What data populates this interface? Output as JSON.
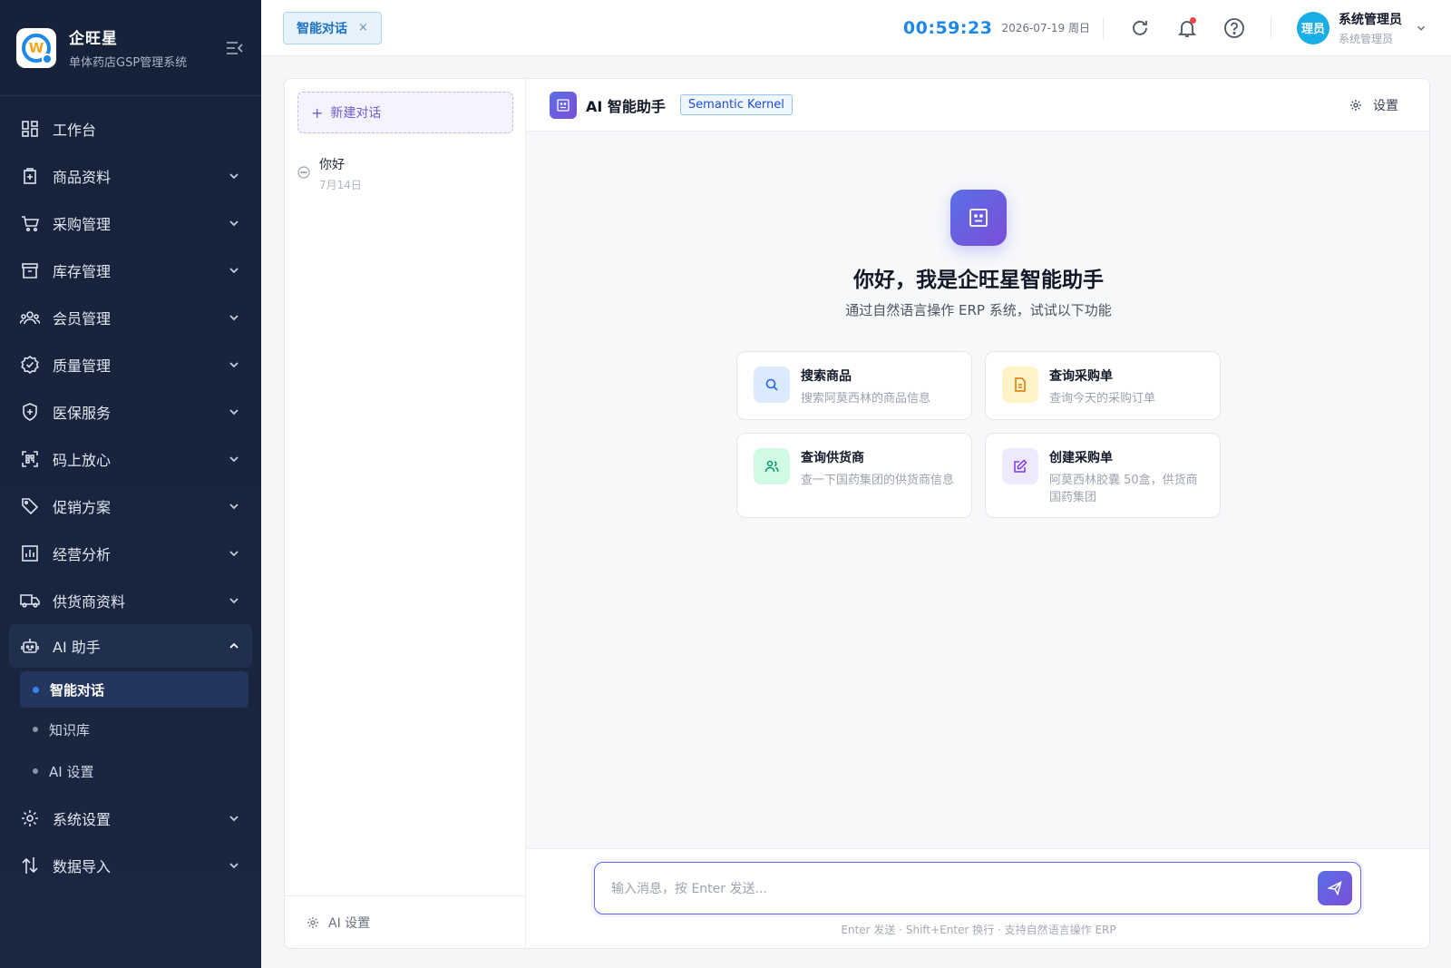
{
  "brand": {
    "name": "企旺星",
    "subtitle": "单体药店GSP管理系统"
  },
  "sidebar": {
    "items": [
      {
        "label": "工作台",
        "icon": "dashboard-icon"
      },
      {
        "label": "商品资料",
        "icon": "product-icon"
      },
      {
        "label": "采购管理",
        "icon": "cart-icon"
      },
      {
        "label": "库存管理",
        "icon": "archive-icon"
      },
      {
        "label": "会员管理",
        "icon": "members-icon"
      },
      {
        "label": "质量管理",
        "icon": "badge-check-icon"
      },
      {
        "label": "医保服务",
        "icon": "shield-plus-icon"
      },
      {
        "label": "码上放心",
        "icon": "qr-scan-icon"
      },
      {
        "label": "促销方案",
        "icon": "tag-icon"
      },
      {
        "label": "经营分析",
        "icon": "bar-chart-icon"
      },
      {
        "label": "供货商资料",
        "icon": "truck-icon"
      },
      {
        "label": "AI 助手",
        "icon": "robot-icon"
      },
      {
        "label": "系统设置",
        "icon": "gear-icon"
      },
      {
        "label": "数据导入",
        "icon": "import-arrows-icon"
      }
    ],
    "ai_sub": [
      {
        "label": "智能对话"
      },
      {
        "label": "知识库"
      },
      {
        "label": "AI 设置"
      }
    ]
  },
  "header": {
    "tab_label": "智能对话",
    "tab_close": "×",
    "clock": "00:59:23",
    "date": "2026-07-19 周日",
    "user_name": "系统管理员",
    "user_role": "系统管理员",
    "avatar_text": "理员"
  },
  "conversations": {
    "new_label": "新建对话",
    "new_plus": "+",
    "items": [
      {
        "title": "你好",
        "date": "7月14日"
      }
    ],
    "footer_label": "AI 设置"
  },
  "chat": {
    "title": "AI 智能助手",
    "badge": "Semantic Kernel",
    "settings_label": "设置",
    "welcome_title": "你好，我是企旺星智能助手",
    "welcome_sub": "通过自然语言操作 ERP 系统，试试以下功能",
    "cards": [
      {
        "title": "搜索商品",
        "desc": "搜索阿莫西林的商品信息",
        "icon": "search-icon",
        "color": "#dbeafe",
        "fg": "#2563eb"
      },
      {
        "title": "查询采购单",
        "desc": "查询今天的采购订单",
        "icon": "document-icon",
        "color": "#fef3c7",
        "fg": "#d97706"
      },
      {
        "title": "查询供货商",
        "desc": "查一下国药集团的供货商信息",
        "icon": "users-icon",
        "color": "#d1fae5",
        "fg": "#059669"
      },
      {
        "title": "创建采购单",
        "desc": "阿莫西林胶囊 50盒，供货商国药集团",
        "icon": "edit-icon",
        "color": "#ede9fe",
        "fg": "#7c3aed"
      }
    ],
    "input_placeholder": "输入消息，按 Enter 发送...",
    "hint": "Enter 发送 · Shift+Enter 换行 · 支持自然语言操作 ERP"
  },
  "colors": {
    "sidebar_bg": "#16223a",
    "accent": "#6366f1",
    "clock": "#1e88e5"
  }
}
